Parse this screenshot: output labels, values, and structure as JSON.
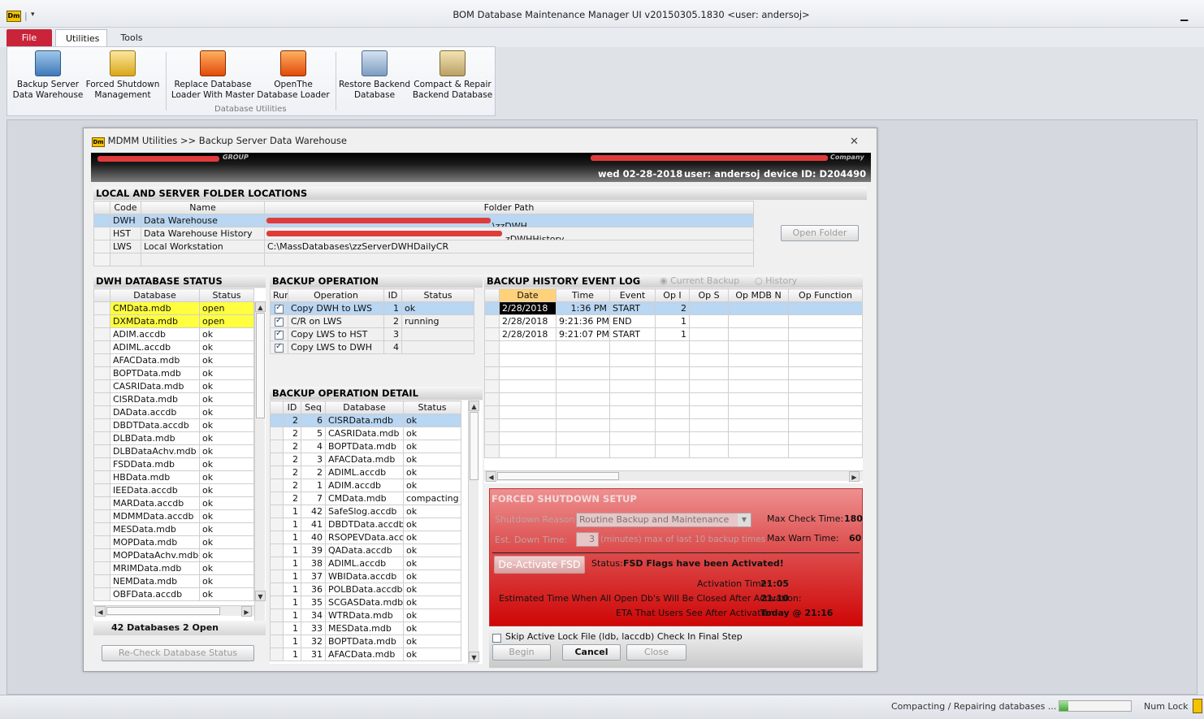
{
  "app": {
    "window_title": "BOM Database Maintenance Manager UI v20150305.1830 <user: andersoj>",
    "logo_text": "Dm"
  },
  "tabs": [
    {
      "label": "File"
    },
    {
      "label": "Utilities"
    },
    {
      "label": "Tools"
    }
  ],
  "ribbon": {
    "buttons": [
      {
        "line1": "Backup Server",
        "line2": "Data Warehouse",
        "icon": "backup-db-icon"
      },
      {
        "line1": "Forced Shutdown",
        "line2": "Management",
        "icon": "lock-db-icon"
      },
      {
        "line1": "Replace Database",
        "line2": "Loader With Master",
        "icon": "replace-loader-icon"
      },
      {
        "line1": "OpenThe",
        "line2": "Database Loader",
        "icon": "open-loader-icon"
      },
      {
        "line1": "Restore Backend",
        "line2": "Database",
        "icon": "restore-db-icon"
      },
      {
        "line1": "Compact & Repair",
        "line2": "Backend Database",
        "icon": "compact-db-icon"
      }
    ],
    "group_label": "Database Utilities"
  },
  "dialog": {
    "title": "MDMM Utilities >> Backup Server Data Warehouse",
    "logo_text": "Dm",
    "header_small_left": "GROUP",
    "header_small_right": "Company",
    "date": "wed 02-28-2018",
    "user": "user: andersoj",
    "device": "device ID: D204490"
  },
  "folders": {
    "title": "LOCAL AND SERVER FOLDER LOCATIONS",
    "columns": [
      "Code",
      "Name",
      "Folder Path"
    ],
    "rows": [
      {
        "code": "DWH",
        "name": "Data Warehouse",
        "path": "\\zzDWH"
      },
      {
        "code": "HST",
        "name": "Data Warehouse History",
        "path": "zDWHHistory"
      },
      {
        "code": "LWS",
        "name": "Local Workstation",
        "path": "C:\\MassDatabases\\zzServerDWHDailyCR"
      }
    ],
    "open_button": "Open Folder"
  },
  "dwh_status": {
    "title": "DWH DATABASE STATUS",
    "columns": [
      "Database",
      "Status"
    ],
    "rows": [
      [
        "CMData.mdb",
        "open"
      ],
      [
        "DXMData.mdb",
        "open"
      ],
      [
        "ADIM.accdb",
        "ok"
      ],
      [
        "ADIML.accdb",
        "ok"
      ],
      [
        "AFACData.mdb",
        "ok"
      ],
      [
        "BOPTData.mdb",
        "ok"
      ],
      [
        "CASRIData.mdb",
        "ok"
      ],
      [
        "CISRData.mdb",
        "ok"
      ],
      [
        "DAData.accdb",
        "ok"
      ],
      [
        "DBDTData.accdb",
        "ok"
      ],
      [
        "DLBData.mdb",
        "ok"
      ],
      [
        "DLBDataAchv.mdb",
        "ok"
      ],
      [
        "FSDData.mdb",
        "ok"
      ],
      [
        "HBData.mdb",
        "ok"
      ],
      [
        "IEEData.accdb",
        "ok"
      ],
      [
        "MARData.accdb",
        "ok"
      ],
      [
        "MDMMData.accdb",
        "ok"
      ],
      [
        "MESData.mdb",
        "ok"
      ],
      [
        "MOPData.mdb",
        "ok"
      ],
      [
        "MOPDataAchv.mdb",
        "ok"
      ],
      [
        "MRIMData.mdb",
        "ok"
      ],
      [
        "NEMData.mdb",
        "ok"
      ],
      [
        "OBFData.accdb",
        "ok"
      ]
    ],
    "summary_count": "42 Databases",
    "summary_open": "2 Open",
    "recheck_button": "Re-Check Database Status"
  },
  "backup_op": {
    "title": "BACKUP OPERATION",
    "columns": [
      "Run",
      "Operation",
      "ID",
      "Status"
    ],
    "rows": [
      {
        "op": "Copy DWH to LWS",
        "id": "1",
        "status": "ok"
      },
      {
        "op": "C/R on LWS",
        "id": "2",
        "status": "running"
      },
      {
        "op": "Copy LWS to HST",
        "id": "3",
        "status": ""
      },
      {
        "op": "Copy LWS to DWH",
        "id": "4",
        "status": ""
      }
    ]
  },
  "backup_detail": {
    "title": "BACKUP OPERATION DETAIL",
    "columns": [
      "ID",
      "Seq",
      "Database",
      "Status"
    ],
    "rows": [
      [
        "2",
        "6",
        "CISRData.mdb",
        "ok"
      ],
      [
        "2",
        "5",
        "CASRIData.mdb",
        "ok"
      ],
      [
        "2",
        "4",
        "BOPTData.mdb",
        "ok"
      ],
      [
        "2",
        "3",
        "AFACData.mdb",
        "ok"
      ],
      [
        "2",
        "2",
        "ADIML.accdb",
        "ok"
      ],
      [
        "2",
        "1",
        "ADIM.accdb",
        "ok"
      ],
      [
        "2",
        "7",
        "CMData.mdb",
        "compacting"
      ],
      [
        "1",
        "42",
        "SafeSlog.accdb",
        "ok"
      ],
      [
        "1",
        "41",
        "DBDTData.accdb",
        "ok"
      ],
      [
        "1",
        "40",
        "RSOPEVData.accd",
        "ok"
      ],
      [
        "1",
        "39",
        "QAData.accdb",
        "ok"
      ],
      [
        "1",
        "38",
        "ADIML.accdb",
        "ok"
      ],
      [
        "1",
        "37",
        "WBIData.accdb",
        "ok"
      ],
      [
        "1",
        "36",
        "POLBData.accdb",
        "ok"
      ],
      [
        "1",
        "35",
        "SCGASData.mdb",
        "ok"
      ],
      [
        "1",
        "34",
        "WTRData.mdb",
        "ok"
      ],
      [
        "1",
        "33",
        "MESData.mdb",
        "ok"
      ],
      [
        "1",
        "32",
        "BOPTData.mdb",
        "ok"
      ],
      [
        "1",
        "31",
        "AFACData.mdb",
        "ok"
      ]
    ]
  },
  "history": {
    "title": "BACKUP HISTORY EVENT LOG",
    "radio_current": "Current Backup",
    "radio_history": "History",
    "columns": [
      "Date",
      "Time",
      "Event",
      "Op I",
      "Op S",
      "Op MDB N",
      "Op Function"
    ],
    "rows": [
      [
        "2/28/2018",
        "1:36 PM",
        "START",
        "2"
      ],
      [
        "2/28/2018",
        "9:21:36 PM",
        "END",
        "1"
      ],
      [
        "2/28/2018",
        "9:21:07 PM",
        "START",
        "1"
      ]
    ]
  },
  "fsd": {
    "title": "FORCED SHUTDOWN SETUP",
    "reason_label": "Shutdown Reason:",
    "reason_value": "Routine Backup and Maintenance",
    "max_check_label": "Max Check Time:",
    "max_check_value": "180",
    "down_label": "Est. Down Time:",
    "down_value": "3",
    "down_hint": "(minutes) max of last 10 backup times",
    "max_warn_label": "Max Warn Time:",
    "max_warn_value": "60",
    "deactivate_button": "De-Activate FSD",
    "status_label": "Status:",
    "status_value": "FSD Flags have been Activated!",
    "activation_label": "Activation Time:",
    "activation_value": "21:05",
    "closed_label": "Estimated Time When All Open Db's Will Be Closed After Activation:",
    "closed_value": "21:10",
    "eta_label": "ETA That Users See After Activation:",
    "eta_value": "Today @ 21:16"
  },
  "bottom": {
    "skip_label": "Skip Active Lock File (ldb, laccdb) Check In Final Step",
    "begin": "Begin",
    "cancel": "Cancel",
    "close": "Close"
  },
  "statusbar": {
    "text": "Compacting / Repairing databases ...",
    "progress": 0.12,
    "numlock": "Num Lock"
  }
}
